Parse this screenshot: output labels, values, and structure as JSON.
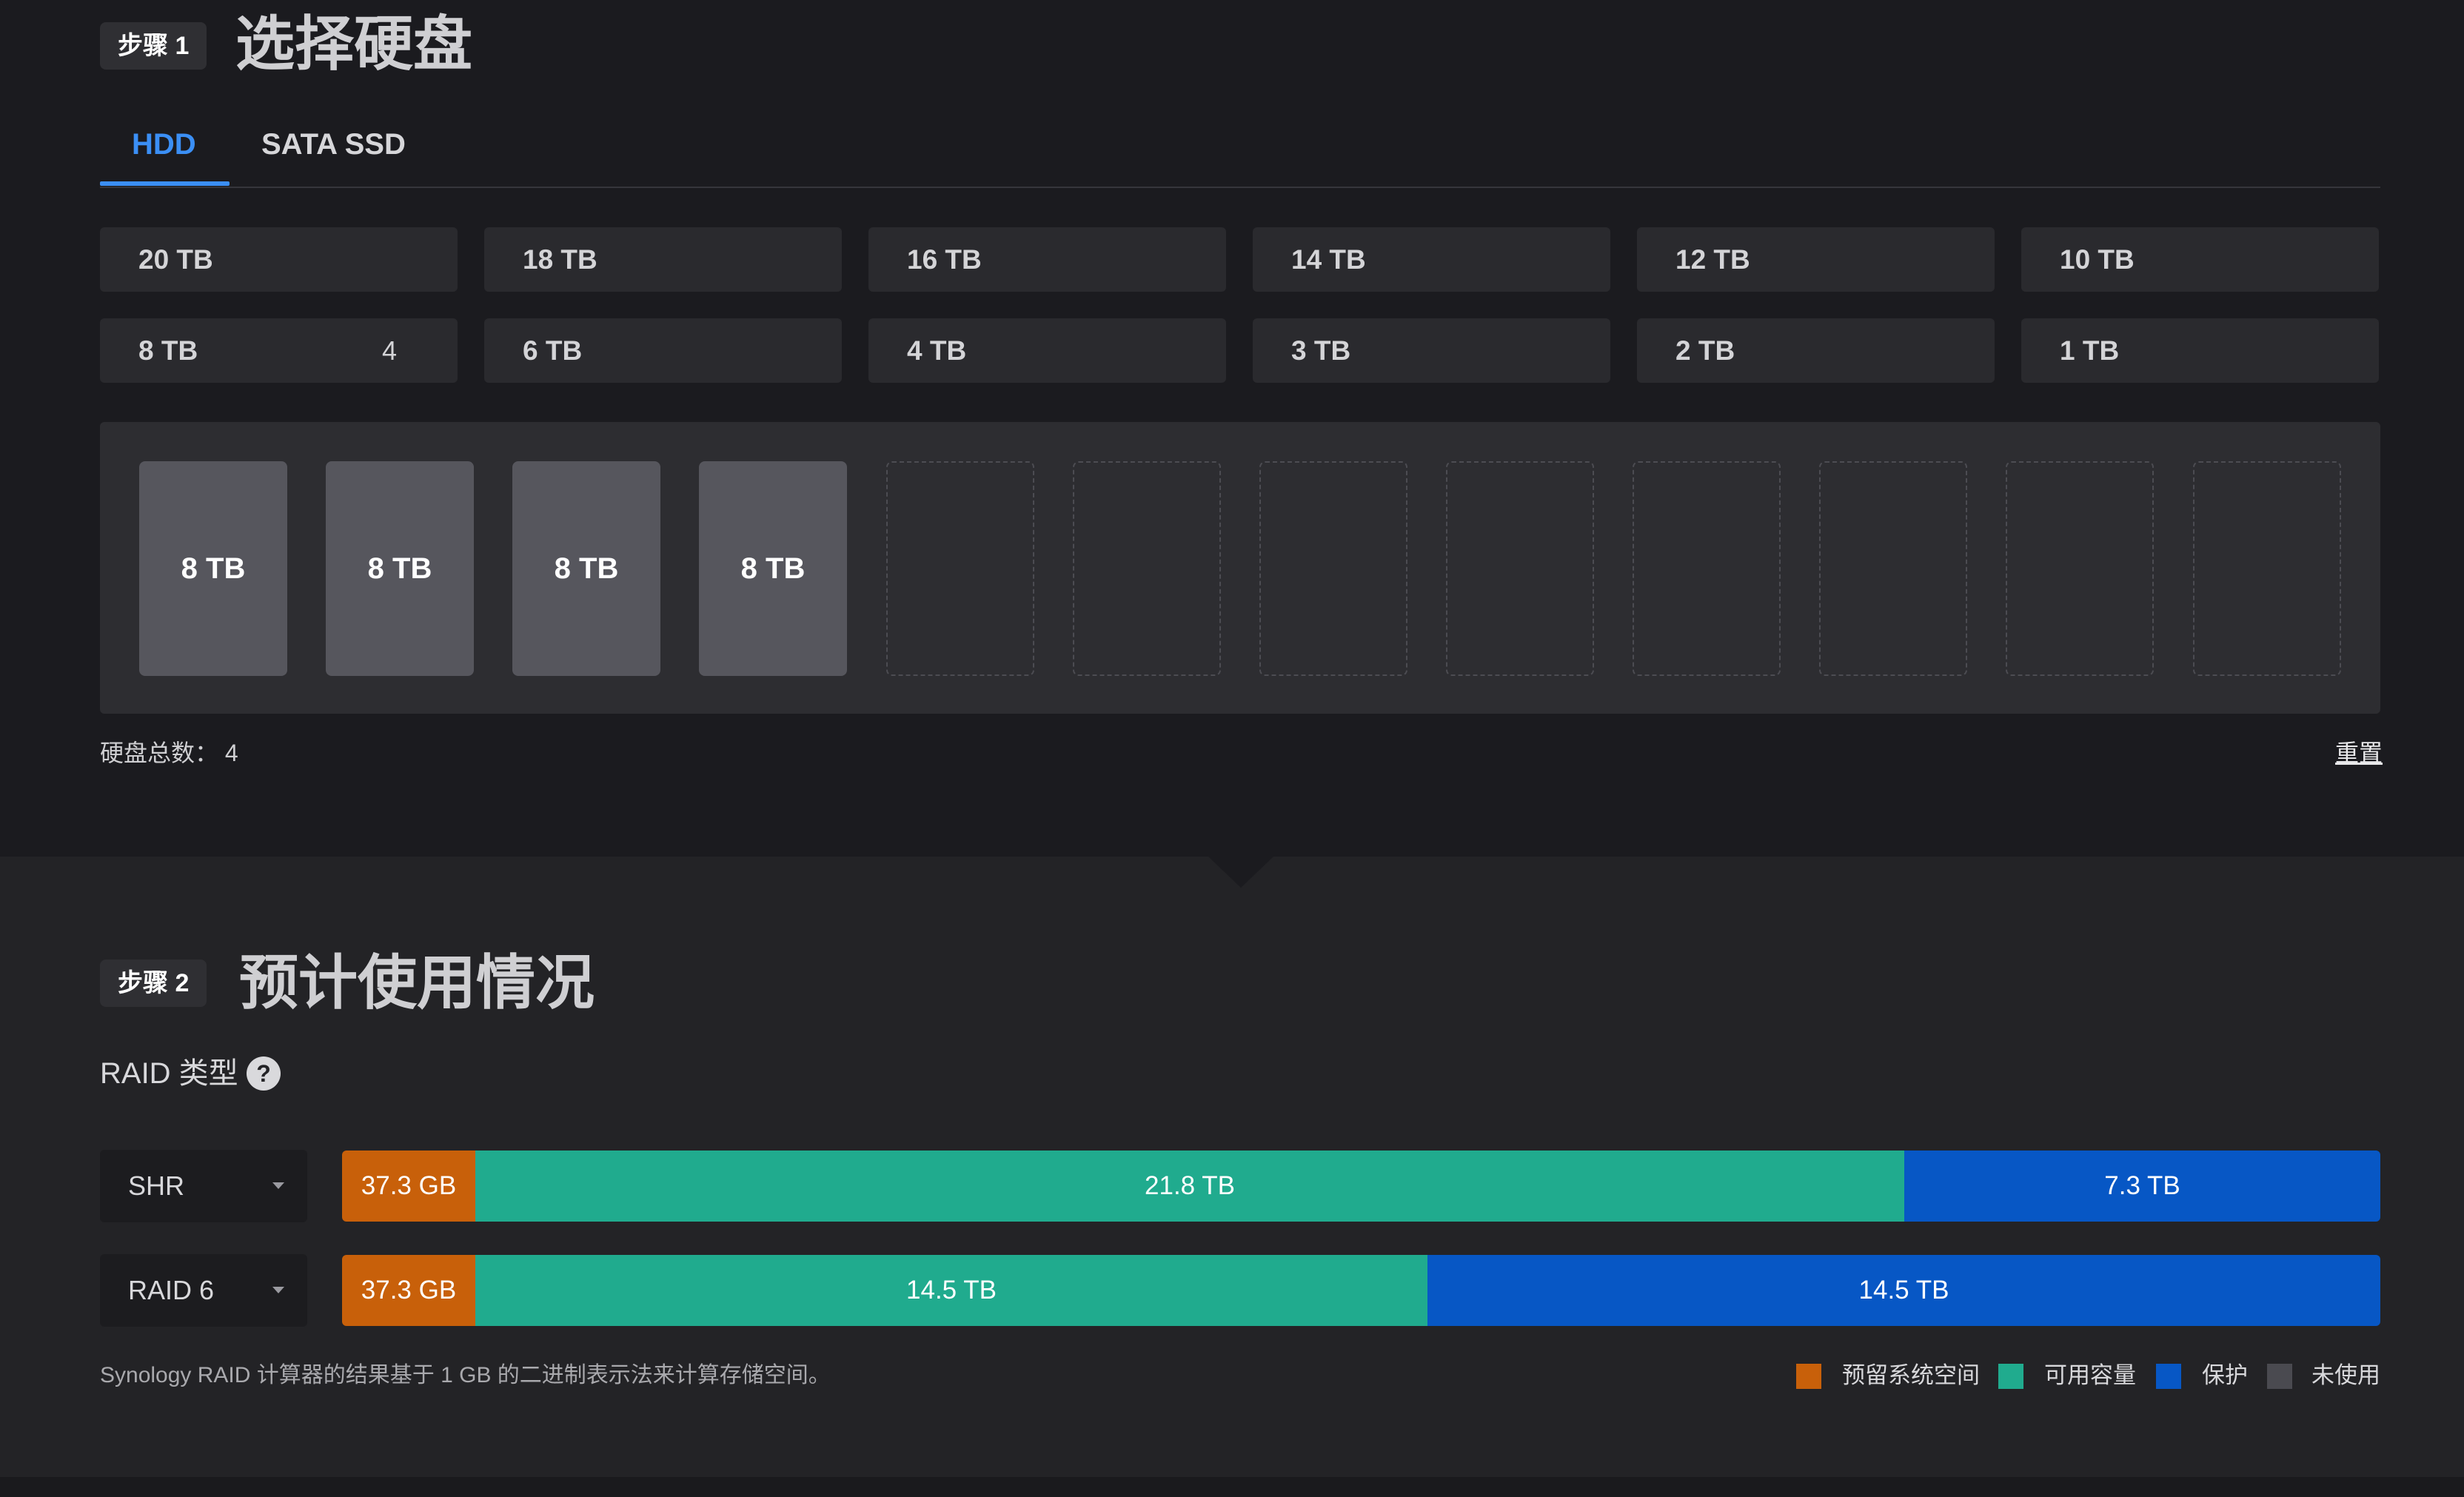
{
  "step1": {
    "badge": "步骤 1",
    "title": "选择硬盘",
    "tabs": [
      {
        "label": "HDD",
        "active": true
      },
      {
        "label": "SATA SSD",
        "active": false
      }
    ],
    "capacities": [
      {
        "label": "20 TB",
        "count": ""
      },
      {
        "label": "18 TB",
        "count": ""
      },
      {
        "label": "16 TB",
        "count": ""
      },
      {
        "label": "14 TB",
        "count": ""
      },
      {
        "label": "12 TB",
        "count": ""
      },
      {
        "label": "10 TB",
        "count": ""
      },
      {
        "label": "8 TB",
        "count": "4"
      },
      {
        "label": "6 TB",
        "count": ""
      },
      {
        "label": "4 TB",
        "count": ""
      },
      {
        "label": "3 TB",
        "count": ""
      },
      {
        "label": "2 TB",
        "count": ""
      },
      {
        "label": "1 TB",
        "count": ""
      }
    ],
    "bays": [
      "8 TB",
      "8 TB",
      "8 TB",
      "8 TB",
      "",
      "",
      "",
      "",
      "",
      "",
      "",
      ""
    ],
    "total_label": "硬盘总数：  4",
    "reset_label": "重置"
  },
  "step2": {
    "badge": "步骤 2",
    "title": "预计使用情况",
    "raid_type_label": "RAID 类型",
    "help_icon": "?",
    "rows": [
      {
        "select": "SHR",
        "system": "37.3 GB",
        "available": "21.8 TB",
        "protection": "7.3 TB"
      },
      {
        "select": "RAID 6",
        "system": "37.3 GB",
        "available": "14.5 TB",
        "protection": "14.5 TB"
      }
    ],
    "footnote": "Synology RAID 计算器的结果基于 1 GB 的二进制表示法来计算存储空间。",
    "legend": [
      {
        "label": "预留系统空间",
        "color": "#c8600a"
      },
      {
        "label": "可用容量",
        "color": "#20ab8e"
      },
      {
        "label": "保护",
        "color": "#0757c5"
      },
      {
        "label": "未使用",
        "color": "#4a4a50"
      }
    ]
  }
}
